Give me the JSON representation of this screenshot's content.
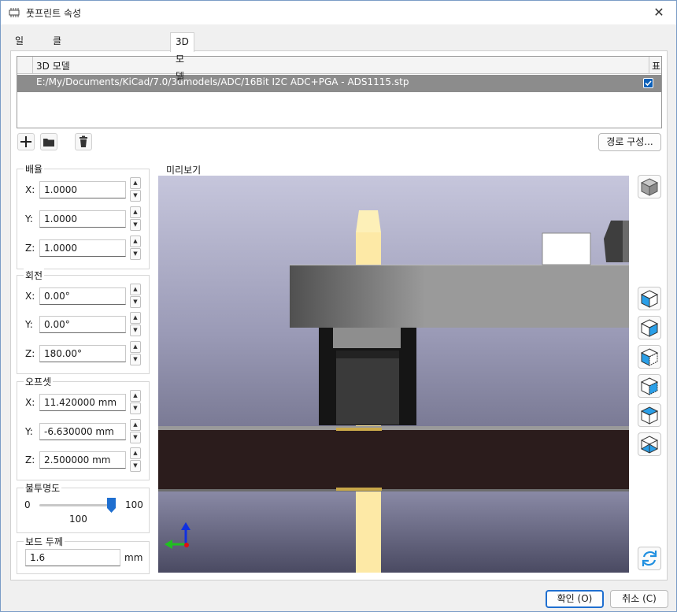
{
  "window": {
    "title": "풋프린트 속성",
    "close_glyph": "✕"
  },
  "tabs": [
    {
      "label": "일반"
    },
    {
      "label": "클리어런스 재정의 및 설정"
    },
    {
      "label": "3D 모델"
    }
  ],
  "models_table": {
    "column_model": "3D 모델",
    "column_show": "표시",
    "rows": [
      {
        "path": "E:/My/Documents/KiCad/7.0/3dmodels/ADC/16Bit I2C ADC+PGA - ADS1115.stp",
        "shown": true
      }
    ]
  },
  "toolbar": {
    "add_icon": "plus-icon",
    "folder_icon": "folder-icon",
    "delete_icon": "trash-icon",
    "path_config_label": "경로 구성..."
  },
  "scale": {
    "title": "배율",
    "x_label": "X:",
    "x_value": "1.0000",
    "y_label": "Y:",
    "y_value": "1.0000",
    "z_label": "Z:",
    "z_value": "1.0000"
  },
  "rotation": {
    "title": "회전",
    "x_label": "X:",
    "x_value": "0.00°",
    "y_label": "Y:",
    "y_value": "0.00°",
    "z_label": "Z:",
    "z_value": "180.00°"
  },
  "offset": {
    "title": "오프셋",
    "x_label": "X:",
    "x_value": "11.420000 mm",
    "y_label": "Y:",
    "y_value": "-6.630000 mm",
    "z_label": "Z:",
    "z_value": "2.500000 mm"
  },
  "opacity": {
    "title": "불투명도",
    "min": "0",
    "max": "100",
    "value": "100",
    "level": 100
  },
  "board_thickness": {
    "title": "보드 두께",
    "value": "1.6",
    "unit": "mm"
  },
  "preview": {
    "label": "미리보기"
  },
  "view_buttons": [
    "view-3d-cube-icon",
    "view-right-icon",
    "view-front-icon",
    "view-left-icon",
    "view-back-icon",
    "view-top-icon",
    "view-bottom-icon",
    "reload-icon"
  ],
  "colors": {
    "accent": "#1f6fd0",
    "selection_row": "#8c8c8c",
    "board": "#2b1c1c"
  },
  "footer": {
    "ok_label": "확인 (O)",
    "cancel_label": "취소 (C)"
  }
}
